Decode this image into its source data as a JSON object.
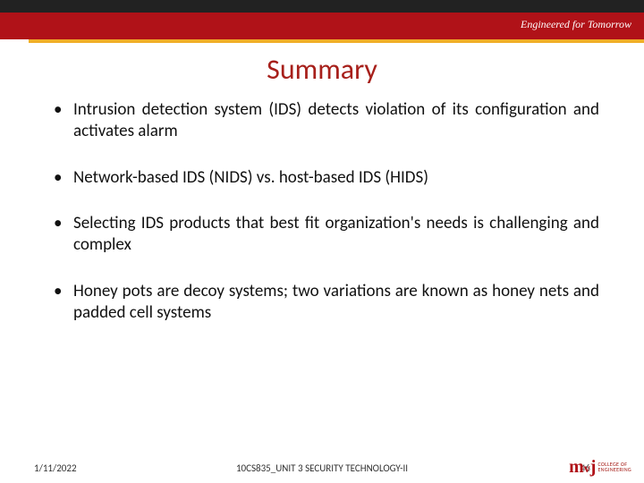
{
  "header": {
    "tagline": "Engineered for Tomorrow"
  },
  "title": "Summary",
  "bullets": [
    "Intrusion detection system (IDS) detects violation of its configuration and activates alarm",
    "Network-based IDS (NIDS) vs. host-based IDS (HIDS)",
    "Selecting IDS products that best fit organization's needs is challenging and complex",
    "Honey pots are decoy systems; two variations are known as honey nets and padded cell systems"
  ],
  "footer": {
    "date": "1/11/2022",
    "reference": "10CS835_UNIT 3 SECURITY TECHNOLOGY-II",
    "slide_number": "46"
  },
  "logo": {
    "mark": "mvj",
    "line1": "COLLEGE OF",
    "line2": "ENGINEERING",
    "sub": ""
  }
}
